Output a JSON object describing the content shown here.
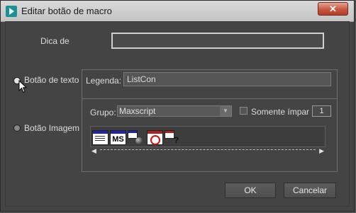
{
  "window": {
    "title": "Editar botão de macro",
    "close_icon": "close-icon",
    "app_icon": "3dsmax-app-icon"
  },
  "form": {
    "tooltip_label": "Dica de",
    "tooltip_value": "",
    "text_button_option": "Botão de texto",
    "image_button_option": "Botão Imagem",
    "selected_option": "Botão de texto",
    "caption_label": "Legenda:",
    "caption_value": "ListCon",
    "group_label": "Grupo:",
    "group_value": "Maxscript",
    "only_odd_label": "Somente ímpar",
    "only_odd_checked": false,
    "count_value": "1",
    "icon_mini_label": "MS",
    "icons": [
      "maxscript-listener-icon",
      "maxscript-ms-icon",
      "maxscript-run-icon",
      "maxscript-stop-icon",
      "maxscript-help-icon"
    ]
  },
  "buttons": {
    "ok": "OK",
    "cancel": "Cancelar"
  },
  "colors": {
    "dialog_bg": "#444444",
    "titlebar": "#cfcfcf",
    "close_button": "#c9553f"
  }
}
